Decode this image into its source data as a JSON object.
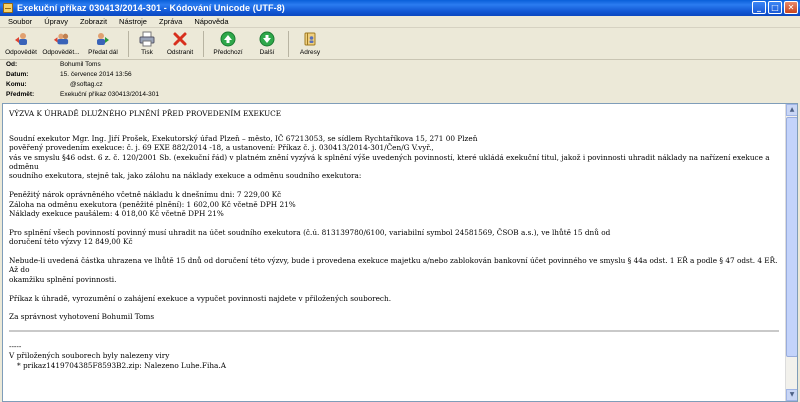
{
  "window": {
    "title": "Exekuční příkaz 030413/2014-301 - Kódování Unicode (UTF-8)"
  },
  "menu": [
    "Soubor",
    "Úpravy",
    "Zobrazit",
    "Nástroje",
    "Zpráva",
    "Nápověda"
  ],
  "toolbar": {
    "reply": "Odpovědět",
    "reply_all": "Odpovědět...",
    "forward": "Předat dál",
    "print": "Tisk",
    "delete": "Odstranit",
    "previous": "Předchozí",
    "next": "Další",
    "addresses": "Adresy"
  },
  "headers": {
    "from_label": "Od:",
    "from": "Bohumil Toms",
    "date_label": "Datum:",
    "date": "15. července 2014 13:56",
    "to_label": "Komu:",
    "to": "@softag.cz",
    "subject_label": "Předmět:",
    "subject": "Exekuční příkaz 030413/2014-301"
  },
  "body": {
    "heading": "VÝZVA K ÚHRADĚ DLUŽNÉHO PLNĚNÍ PŘED PROVEDENÍM EXEKUCE",
    "p1_l1": "Soudní exekutor Mgr. Ing. Jiří Prošek, Exekutorský úřad Plzeň – město, IČ 67213053, se sídlem Rychtaříkova 15, 271 00 Plzeň",
    "p1_l2": "pověřený provedením exekuce: č. j. 69 EXE 882/2014 -18, a ustanovení: Příkaz č. j. 030413/2014-301/Čen/G V.vyř.,",
    "p1_l3": "vás ve smyslu §46 odst. 6 z. č. 120/2001 Sb. (exekuční řád) v platném znění vyzývá k splnění výše uvedených povinností, které ukládá exekuční titul, jakož i povinnosti uhradit náklady na nařízení exekuce a odměnu",
    "p1_l4": "soudního exekutora, stejně tak, jako zálohu na náklady exekuce a odměnu soudního exekutora:",
    "amt1": "Peněžitý nárok oprávněného včetně nákladu k dnešnímu dni: 7 229,00 Kč",
    "amt2": "Záloha na odměnu exekutora (peněžité plnění): 1 602,00 Kč včetně DPH 21%",
    "amt3": "Náklady exekuce paušálem: 4 018,00 Kč včetně DPH 21%",
    "p2_l1": "Pro splnění všech povinností povinný musí uhradit na účet soudního exekutora (č.ú. 813139780/6100, variabilní symbol 24581569, ČSOB a.s.), ve lhůtě 15 dnů od",
    "p2_l2": "doručení této výzvy 12 849,00 Kč",
    "p3_l1": "Nebude-li uvedená částka uhrazena ve lhůtě 15 dnů od doručení této výzvy, bude i provedena exekuce majetku a/nebo zablokován bankovní účet povinného ve smyslu § 44a odst. 1 EŘ a podle § 47 odst. 4 EŘ. Až do",
    "p3_l2": "okamžiku splnění povinnosti.",
    "p4": "Příkaz k úhradě, vyrozumění o zahájení exekuce a vypučet povinnosti najdete v přiložených souborech.",
    "p5": "Za správnost vyhotovení Bohumil Toms",
    "dashes": "-----",
    "virus_note": "V přiložených souborech byly nalezeny viry",
    "virus_item": "* prikaz1419704385F8593B2.zip: Nalezeno Luhe.Fiha.A"
  }
}
